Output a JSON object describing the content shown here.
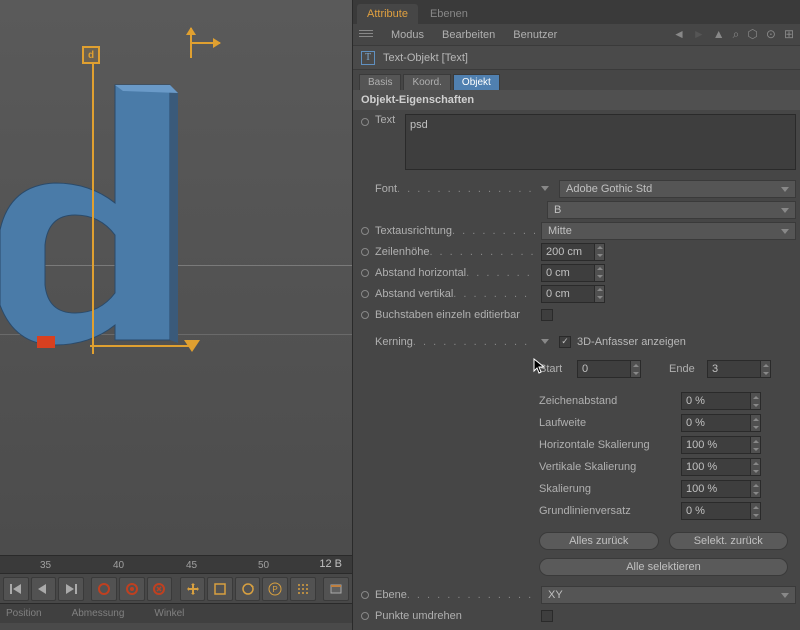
{
  "tabs": {
    "attribute": "Attribute",
    "ebenen": "Ebenen"
  },
  "menu": {
    "modus": "Modus",
    "bearbeiten": "Bearbeiten",
    "benutzer": "Benutzer"
  },
  "object_header": "Text-Objekt [Text]",
  "subtabs": {
    "basis": "Basis",
    "koord": "Koord.",
    "objekt": "Objekt"
  },
  "section": "Objekt-Eigenschaften",
  "props": {
    "text_label": "Text",
    "text_value": "psd",
    "font_label": "Font",
    "font_value": "Adobe Gothic Std",
    "font_weight": "B",
    "textausrichtung_label": "Textausrichtung",
    "textausrichtung_value": "Mitte",
    "zeilenhoehe_label": "Zeilenhöhe",
    "zeilenhoehe_value": "200 cm",
    "abstand_h_label": "Abstand horizontal",
    "abstand_h_value": "0 cm",
    "abstand_v_label": "Abstand vertikal",
    "abstand_v_value": "0 cm",
    "buchstaben_label": "Buchstaben einzeln editierbar",
    "kerning_label": "Kerning",
    "anfasser_label": "3D-Anfasser anzeigen",
    "start_label": "Start",
    "start_value": "0",
    "ende_label": "Ende",
    "ende_value": "3",
    "zeichenabstand_label": "Zeichenabstand",
    "zeichenabstand_value": "0 %",
    "laufweite_label": "Laufweite",
    "laufweite_value": "0 %",
    "h_skalierung_label": "Horizontale Skalierung",
    "h_skalierung_value": "100 %",
    "v_skalierung_label": "Vertikale Skalierung",
    "v_skalierung_value": "100 %",
    "skalierung_label": "Skalierung",
    "skalierung_value": "100 %",
    "grundlinien_label": "Grundlinienversatz",
    "grundlinien_value": "0 %",
    "ebene_label": "Ebene",
    "ebene_value": "XY",
    "punkte_label": "Punkte umdrehen"
  },
  "buttons": {
    "alles_zurueck": "Alles zurück",
    "selekt_zurueck": "Selekt. zurück",
    "alle_selektieren": "Alle selektieren"
  },
  "ruler": {
    "t35": "35",
    "t40": "40",
    "t45": "45",
    "t50": "50",
    "value": "12 B"
  },
  "status": {
    "position": "Position",
    "abmessung": "Abmessung",
    "winkel": "Winkel"
  },
  "handle_letter": "d"
}
